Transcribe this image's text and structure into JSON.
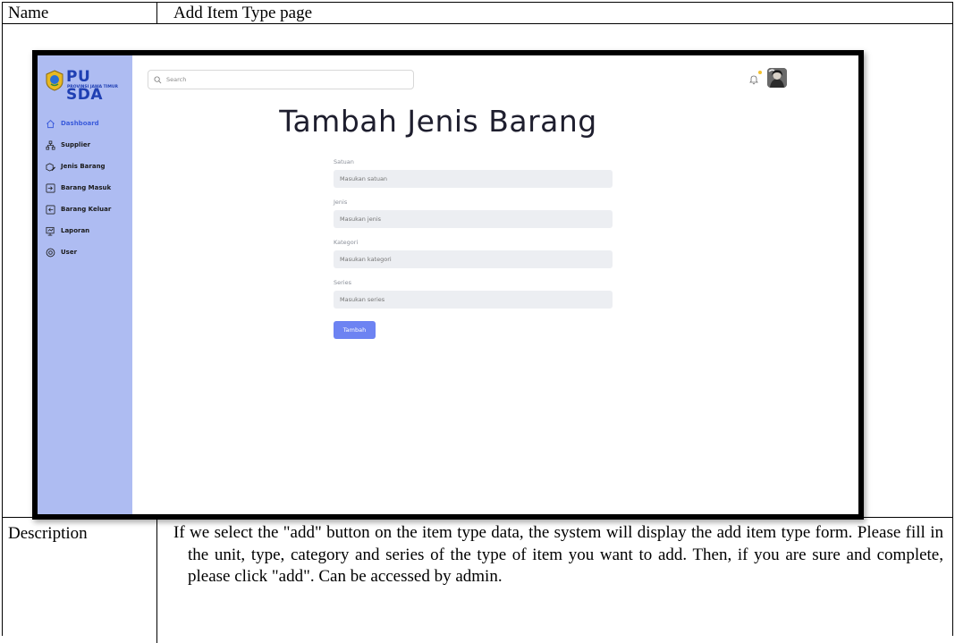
{
  "table": {
    "name_label": "Name",
    "name_value": "Add Item Type page",
    "description_label": "Description",
    "description_text": "If we select the \"add\" button on the item type data, the system will display the add item type form. Please fill in the unit, type, category and series of the type of item you want to add. Then, if you are sure and complete, please click \"add\". Can be accessed by admin."
  },
  "app": {
    "logo_title": "PU SDA",
    "logo_subtitle": "PROVINSI JAWA TIMUR",
    "search_placeholder": "Search",
    "page_title": "Tambah Jenis Barang",
    "sidebar": {
      "items": [
        {
          "label": "Dashboard",
          "icon": "home-icon",
          "active": true
        },
        {
          "label": "Supplier",
          "icon": "network-icon",
          "active": false
        },
        {
          "label": "Jenis Barang",
          "icon": "box-edit-icon",
          "active": false
        },
        {
          "label": "Barang Masuk",
          "icon": "inbox-in-icon",
          "active": false
        },
        {
          "label": "Barang Keluar",
          "icon": "inbox-out-icon",
          "active": false
        },
        {
          "label": "Laporan",
          "icon": "report-icon",
          "active": false
        },
        {
          "label": "User",
          "icon": "user-settings-icon",
          "active": false
        }
      ]
    },
    "form": {
      "fields": [
        {
          "label": "Satuan",
          "placeholder": "Masukan satuan"
        },
        {
          "label": "Jenis",
          "placeholder": "Masukan jenis"
        },
        {
          "label": "Kategori",
          "placeholder": "Masukan kategori"
        },
        {
          "label": "Series",
          "placeholder": "Masukan series"
        }
      ],
      "submit_label": "Tambah"
    },
    "colors": {
      "sidebar_bg": "#aebcf2",
      "accent": "#6d83f2",
      "active_nav": "#3b5bdb",
      "input_bg": "#eceef2",
      "notification_dot": "#f2c12e"
    }
  }
}
